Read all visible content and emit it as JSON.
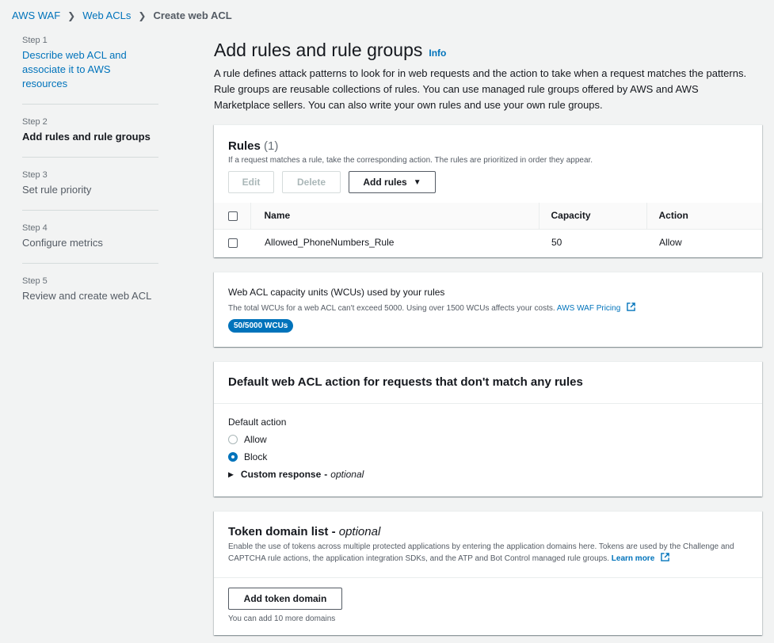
{
  "breadcrumb": {
    "items": [
      "AWS WAF",
      "Web ACLs"
    ],
    "current": "Create web ACL"
  },
  "steps": [
    {
      "num": "Step 1",
      "title": "Describe web ACL and associate it to AWS resources"
    },
    {
      "num": "Step 2",
      "title": "Add rules and rule groups"
    },
    {
      "num": "Step 3",
      "title": "Set rule priority"
    },
    {
      "num": "Step 4",
      "title": "Configure metrics"
    },
    {
      "num": "Step 5",
      "title": "Review and create web ACL"
    }
  ],
  "page": {
    "title": "Add rules and rule groups",
    "info": "Info",
    "description": "A rule defines attack patterns to look for in web requests and the action to take when a request matches the patterns. Rule groups are reusable collections of rules. You can use managed rule groups offered by AWS and AWS Marketplace sellers. You can also write your own rules and use your own rule groups."
  },
  "rules": {
    "title": "Rules",
    "count": "(1)",
    "subtitle": "If a request matches a rule, take the corresponding action. The rules are prioritized in order they appear.",
    "edit_label": "Edit",
    "delete_label": "Delete",
    "add_label": "Add rules",
    "columns": [
      "Name",
      "Capacity",
      "Action"
    ],
    "rows": [
      {
        "name": "Allowed_PhoneNumbers_Rule",
        "capacity": "50",
        "action": "Allow"
      }
    ]
  },
  "wcu": {
    "title": "Web ACL capacity units (WCUs) used by your rules",
    "description": "The total WCUs for a web ACL can't exceed 5000. Using over 1500 WCUs affects your costs.",
    "pricing_link": "AWS WAF Pricing",
    "badge": "50/5000 WCUs"
  },
  "default_action": {
    "title": "Default web ACL action for requests that don't match any rules",
    "label": "Default action",
    "options": [
      "Allow",
      "Block"
    ],
    "selected": "Block",
    "custom_response": "Custom response",
    "custom_optional": "optional"
  },
  "token": {
    "title": "Token domain list",
    "optional": "optional",
    "description": "Enable the use of tokens across multiple protected applications by entering the application domains here. Tokens are used by the Challenge and CAPTCHA rule actions, the application integration SDKs, and the ATP and Bot Control managed rule groups.",
    "learn_more": "Learn more",
    "add_label": "Add token domain",
    "hint": "You can add 10 more domains"
  },
  "colors": {
    "link": "#0073bb",
    "badge": "#0073bb"
  }
}
